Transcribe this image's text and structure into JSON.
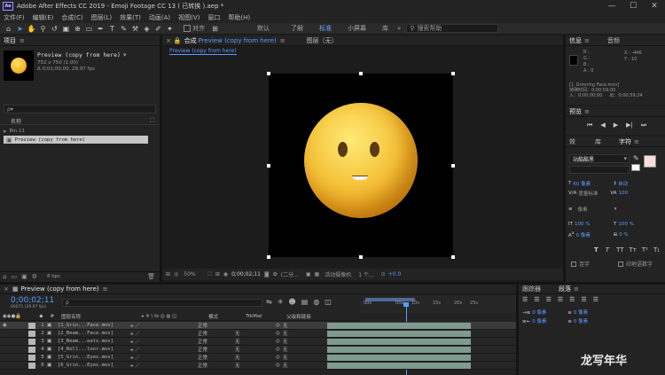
{
  "title_bar": {
    "app_badge": "Ae",
    "title": "Adobe After Effects CC 2019 - Emoji Footage CC 13 ( 已转换 ).aep *"
  },
  "menu": [
    "文件(F)",
    "编辑(E)",
    "合成(C)",
    "图层(L)",
    "效果(T)",
    "动画(A)",
    "视图(V)",
    "窗口",
    "帮助(H)"
  ],
  "toolbar": {
    "snap_label": "对齐",
    "workspaces": [
      {
        "label": "默认",
        "active": false
      },
      {
        "label": "了解",
        "active": false
      },
      {
        "label": "标准",
        "active": true
      },
      {
        "label": "小屏幕",
        "active": false
      },
      {
        "label": "库",
        "active": false
      }
    ],
    "search_help": "搜索帮助"
  },
  "project": {
    "tab": "项目",
    "item_name": "Preview (copy from here)",
    "item_dims": "752 x 750 (1.00)",
    "item_duration": "Δ 0;01;00;00, 29.97 fps",
    "search_placeholder": "ρ▾",
    "col_name": "名称",
    "rows": [
      "Bin.11",
      "Preview (copy from here)"
    ],
    "bpc": "8 bpc"
  },
  "composition": {
    "tab_prefix": "合成",
    "tab_name": "Preview (copy from here)",
    "layer_tab": "图层（无）",
    "breadcrumb": "Preview (copy from here)",
    "zoom": "50%",
    "timecode": "0;00;02;11",
    "resolution": "(二分...",
    "camera": "活动摄像机",
    "views": "1 个...",
    "exposure": "+0.0"
  },
  "info": {
    "tab_info": "信息",
    "tab_audio": "音频",
    "r": "R :",
    "g": "G :",
    "b": "B :",
    "a": "A :  0",
    "x": "X : -446",
    "y": "Y : 10",
    "layer_name": "[1_Grinning Face.mov]",
    "duration_label": "持续时间：0;00;59;00",
    "in_out": "入：0;00;00;00",
    "out": "出：0;00;59;24"
  },
  "preview": {
    "tab": "预览"
  },
  "paragraph": {
    "tab_effects": "效",
    "tab_align": "库",
    "tab_char": "字符"
  },
  "character": {
    "font": "站酷酷黑",
    "font_size": "60 像素",
    "leading": "自动",
    "tracking_label": "度量标准",
    "tracking": "100",
    "stroke": "像素",
    "vscale": "100 %",
    "hscale": "100 %",
    "baseline": "0 像素",
    "tsume": "0 %",
    "ligature": "连字",
    "hindi_digits": "印地语数字"
  },
  "tracker": {
    "tab_tracker": "跟踪器",
    "tab_para": "段落"
  },
  "para_values": {
    "indent_left": "0 像素",
    "indent_right": "0 像素",
    "space_before": "0 像素",
    "space_after": "0 像素"
  },
  "timeline": {
    "comp_tab": "Preview (copy from here)",
    "timecode": "0;00;02;11",
    "timecode_sub": "00071 (29.97 fps)",
    "search_placeholder": "ρ",
    "col_layer_name": "图层名称",
    "col_mode": "模式",
    "col_trkmat": "TrkMat",
    "col_parent": "父级和链接",
    "ruler": [
      "00s",
      "05s",
      "10s",
      "15s",
      "20s",
      "25s"
    ],
    "layers": [
      {
        "idx": "1",
        "name": "[1_Grin...Face.mov]",
        "mode": "正常",
        "trkmat": "",
        "parent": "无"
      },
      {
        "idx": "2",
        "name": "[2_Beam...Face.mov]",
        "mode": "正常",
        "trkmat": "无",
        "parent": "无"
      },
      {
        "idx": "3",
        "name": "[3_Beam...eats.mov]",
        "mode": "正常",
        "trkmat": "无",
        "parent": "无"
      },
      {
        "idx": "4",
        "name": "[4_Roll...loor.mov]",
        "mode": "正常",
        "trkmat": "无",
        "parent": "无"
      },
      {
        "idx": "5",
        "name": "[5_Grin...Eyes.mov]",
        "mode": "正常",
        "trkmat": "无",
        "parent": "无"
      },
      {
        "idx": "6",
        "name": "[6_Grin...Eyes.mov]",
        "mode": "正常",
        "trkmat": "无",
        "parent": "无"
      }
    ]
  },
  "watermark": "龙写年华",
  "colors": {
    "accent": "#5a9bff",
    "emoji": "#f3b62a",
    "bg": "#1d1d1d",
    "panel": "#232323"
  }
}
